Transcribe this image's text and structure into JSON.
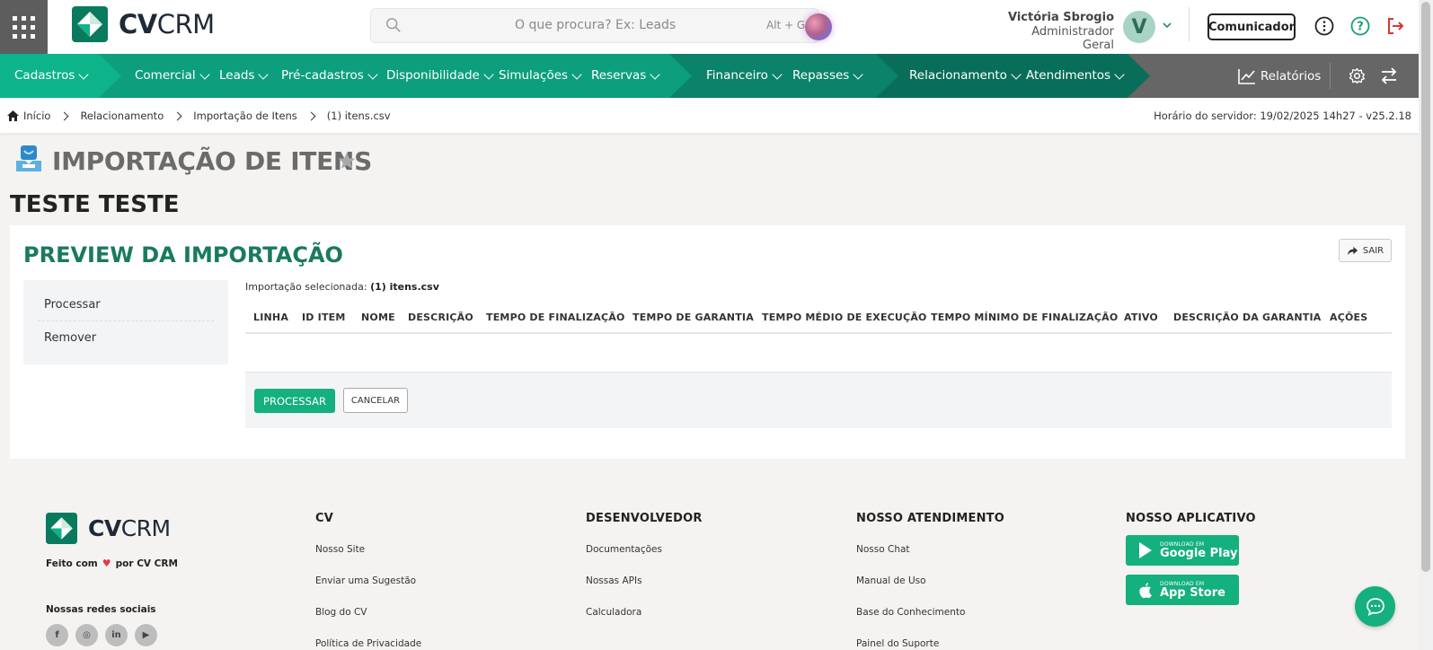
{
  "header": {
    "logo_bold": "CV",
    "logo_light": "CRM",
    "search_placeholder": "O que procura? Ex: Leads",
    "search_shortcut": "Alt + G",
    "user_name": "Victória Sbrogio",
    "user_role": "Administrador Geral",
    "avatar_initial": "V",
    "comunicador_label": "Comunicador"
  },
  "nav": {
    "items": [
      {
        "label": "Cadastros"
      },
      {
        "label": "Comercial"
      },
      {
        "label": "Leads"
      },
      {
        "label": "Pré-cadastros"
      },
      {
        "label": "Disponibilidade"
      },
      {
        "label": "Simulações"
      },
      {
        "label": "Reservas"
      },
      {
        "label": "Financeiro"
      },
      {
        "label": "Repasses"
      },
      {
        "label": "Relacionamento"
      },
      {
        "label": "Atendimentos"
      }
    ],
    "reports_label": "Relatórios",
    "colors": {
      "segment1": "#0db389",
      "segment2": "#0d9e7d",
      "segment3": "#0b826a",
      "segment4": "#096e59",
      "tail": "#666666"
    }
  },
  "breadcrumb": {
    "items": [
      "Início",
      "Relacionamento",
      "Importação de Itens",
      "(1) itens.csv"
    ],
    "server_time": "Horário do servidor: 19/02/2025 14h27 - v25.2.18"
  },
  "page": {
    "title": "IMPORTAÇÃO DE ITENS",
    "subtitle": "TESTE TESTE"
  },
  "card": {
    "title": "PREVIEW DA IMPORTAÇÃO",
    "exit_label": "SAIR",
    "menu": [
      "Processar",
      "Remover"
    ],
    "selected_label": "Importação selecionada:",
    "selected_file": "(1) itens.csv",
    "columns": [
      "LINHA",
      "ID ITEM",
      "NOME",
      "DESCRIÇÃO",
      "TEMPO DE FINALIZAÇÃO",
      "TEMPO DE GARANTIA",
      "TEMPO MÉDIO DE EXECUÇÃO",
      "TEMPO MÍNIMO DE FINALIZAÇÃO",
      "ATIVO",
      "DESCRIÇÃO DA GARANTIA",
      "AÇÕES"
    ],
    "process_label": "PROCESSAR",
    "cancel_label": "CANCELAR"
  },
  "footer": {
    "made_with_prefix": "Feito com",
    "made_with_suffix": "por CV CRM",
    "social_title": "Nossas redes sociais",
    "social": [
      {
        "icon": "facebook-icon",
        "glyph": "f"
      },
      {
        "icon": "instagram-icon",
        "glyph": "◎"
      },
      {
        "icon": "linkedin-icon",
        "glyph": "in"
      },
      {
        "icon": "youtube-icon",
        "glyph": "▶"
      }
    ],
    "columns": [
      {
        "title": "CV",
        "links": [
          "Nosso Site",
          "Enviar uma Sugestão",
          "Blog do CV",
          "Política de Privacidade"
        ]
      },
      {
        "title": "DESENVOLVEDOR",
        "links": [
          "Documentações",
          "Nossas APIs",
          "Calculadora"
        ]
      },
      {
        "title": "NOSSO ATENDIMENTO",
        "links": [
          "Nosso Chat",
          "Manual de Uso",
          "Base do Conhecimento",
          "Painel do Suporte"
        ]
      },
      {
        "title": "NOSSO APLICATIVO",
        "links": []
      }
    ],
    "google_play_small": "DOWNLOAD EM",
    "google_play_big": "Google Play",
    "app_store_small": "DOWNLOAD EM",
    "app_store_big": "App Store"
  }
}
